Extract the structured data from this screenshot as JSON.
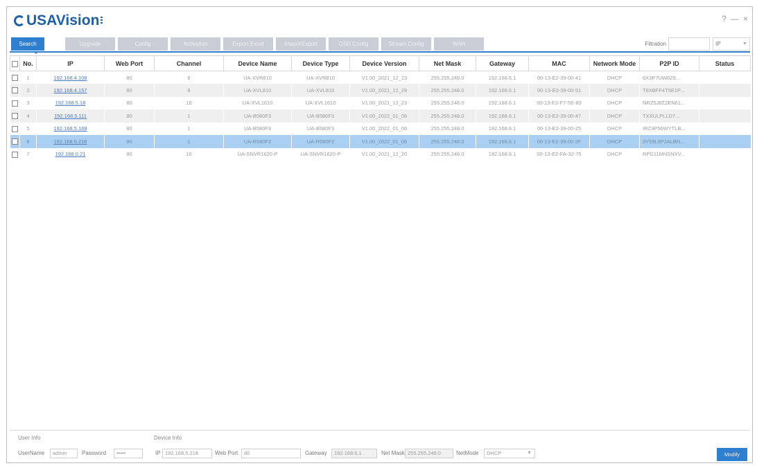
{
  "app": {
    "logo_text": "USAVision",
    "window_controls": [
      "?",
      "—",
      "×"
    ]
  },
  "toolbar": {
    "buttons": [
      {
        "label": "Search",
        "active": true
      },
      {
        "label": "Upgrade",
        "active": false
      },
      {
        "label": "Config",
        "active": false
      },
      {
        "label": "Activation",
        "active": false
      },
      {
        "label": "Export Excel",
        "active": false
      },
      {
        "label": "Import/Export",
        "active": false
      },
      {
        "label": "OSD Config",
        "active": false
      },
      {
        "label": "Stream Config",
        "active": false
      },
      {
        "label": "WAN",
        "active": false
      }
    ],
    "filtration_label": "Filtration",
    "filtration_value": "",
    "filter_type": "IP"
  },
  "table": {
    "columns": [
      "No.",
      "IP",
      "Web Port",
      "Channel",
      "Device Name",
      "Device Type",
      "Device Version",
      "Net Mask",
      "Gateway",
      "MAC",
      "Network Mode",
      "P2P ID",
      "Status"
    ],
    "rows": [
      [
        "1",
        "192.168.4.108",
        "80",
        "8",
        "UA-XVR810",
        "UA-XVR810",
        "V1.00_2021_12_23",
        "255.255.248.0",
        "192.168.6.1",
        "00-13-E2-39-00-41",
        "DHCP",
        "6X3P7UW6Z6...",
        ""
      ],
      [
        "2",
        "192.168.4.157",
        "80",
        "8",
        "UA-XVL810",
        "UA-XVL810",
        "V1.00_2021_12_29",
        "255.255.248.0",
        "192.168.6.1",
        "00-13-E2-39-00-51",
        "DHCP",
        "T8XBFF4T5E1P...",
        ""
      ],
      [
        "3",
        "192.168.5.18",
        "80",
        "16",
        "UA-XVL1610",
        "UA-XVL1610",
        "V1.00_2021_12_23",
        "255.255.248.0",
        "192.168.6.1",
        "00-13-E2-F7-5E-83",
        "DHCP",
        "NRZ5J8Z2EN61...",
        ""
      ],
      [
        "4",
        "192.168.5.111",
        "80",
        "1",
        "UA-B580F3",
        "UA-B580F3",
        "V1.00_2022_01_06",
        "255.255.248.0",
        "192.168.6.1",
        "00-13-E2-39-00-47",
        "DHCP",
        "TXXULPLLD7...",
        ""
      ],
      [
        "5",
        "192.168.5.169",
        "80",
        "1",
        "UA-B580F3",
        "UA-B580F3",
        "V1.00_2022_01_06",
        "255.255.248.0",
        "192.168.6.1",
        "00-13-E2-39-00-25",
        "DHCP",
        "IRZ3P56WYTLB...",
        ""
      ],
      [
        "6",
        "192.168.5.218",
        "80",
        "1",
        "UA-R580F2",
        "UA-R580F2",
        "V1.00_2022_01_06",
        "255.255.248.0",
        "192.168.6.1",
        "00-13-E2-39-00-2F",
        "DHCP",
        "3Y59L9PJALBN...",
        ""
      ],
      [
        "7",
        "192.168.0.21",
        "80",
        "16",
        "UA-SNVR1620-P",
        "UA-SNVR1620-P",
        "V1.00_2021_12_20",
        "255.255.248.0",
        "192.168.6.1",
        "00-13-E2-FA-32-75",
        "DHCP",
        "RPD11MNSNXV...",
        ""
      ]
    ],
    "selected_row": 5
  },
  "user_info": {
    "section_label": "User Info",
    "username_label": "UserName",
    "username_value": "admin",
    "password_label": "Password",
    "password_value": "•••••"
  },
  "device_info": {
    "section_label": "Device Info",
    "ip_label": "IP",
    "ip_value": "192.168.5.218",
    "web_port_label": "Web Port",
    "web_port_value": "80",
    "gateway_label": "Gateway",
    "gateway_value": "192.168.6.1",
    "net_mask_label": "Net Mask",
    "net_mask_value": "255.255.248.0",
    "net_mode_label": "NetMode",
    "net_mode_value": "DHCP"
  },
  "modify_button": "Modify",
  "colors": {
    "accent": "#2f7fd0",
    "selected_row": "#a9d0f2",
    "disabled_button": "#c9ced6"
  }
}
